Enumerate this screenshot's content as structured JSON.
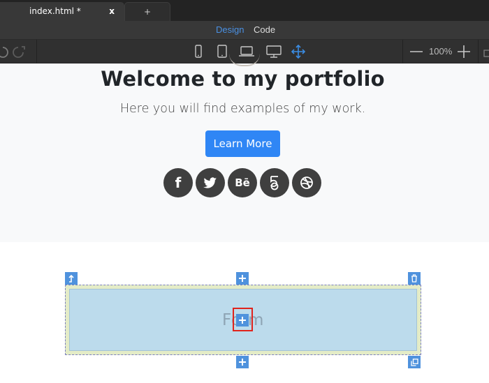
{
  "tabs": {
    "active": {
      "title": "index.html *",
      "close": "x"
    },
    "new": "+"
  },
  "modes": {
    "design": "Design",
    "code": "Code"
  },
  "toolbar": {
    "devices": [
      "phone-icon",
      "tablet-icon",
      "laptop-icon",
      "desktop-icon",
      "move-icon"
    ],
    "zoom": "100%"
  },
  "hero": {
    "title": "Welcome to my portfolio",
    "subtitle": "Here you will find examples of my work.",
    "button": "Learn More",
    "socials": [
      {
        "icon": "facebook-icon",
        "glyph": "f"
      },
      {
        "icon": "twitter-icon",
        "glyph": ""
      },
      {
        "icon": "behance-icon",
        "glyph": "Bē"
      },
      {
        "icon": "500px-icon",
        "glyph": "5"
      },
      {
        "icon": "dribbble-icon",
        "glyph": ""
      }
    ]
  },
  "form": {
    "label": "Form"
  },
  "colors": {
    "accent": "#4a90e2",
    "button": "#2f86f5",
    "selection": "#4f92dd",
    "highlight": "#e0231c",
    "formFill": "#bcdbec",
    "formPadding": "#e4ecc7"
  }
}
